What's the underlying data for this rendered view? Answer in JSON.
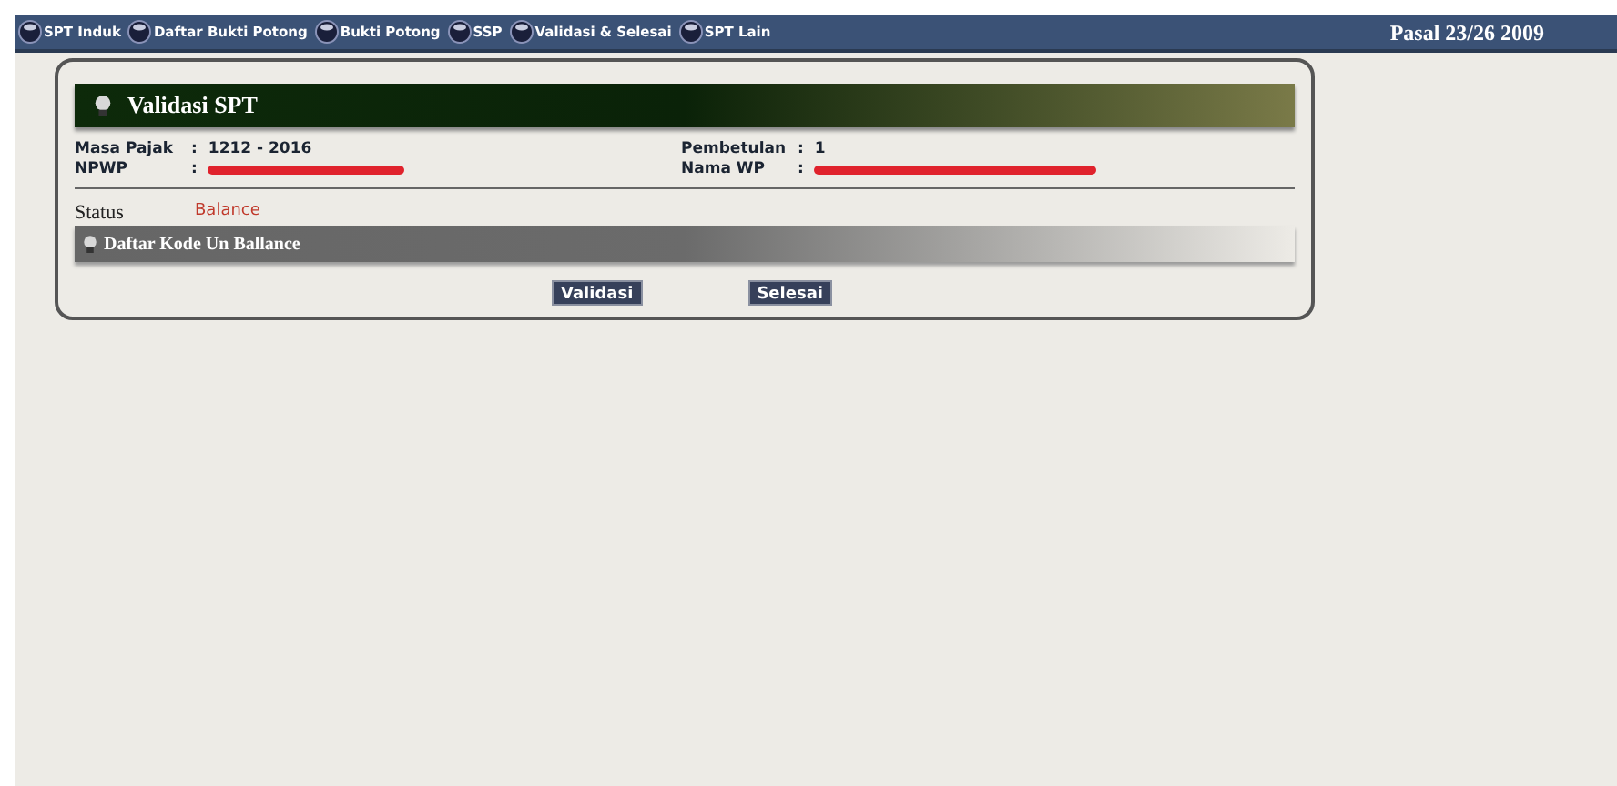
{
  "menu": [
    {
      "label": "SPT Induk"
    },
    {
      "label": "Daftar Bukti Potong"
    },
    {
      "label": "Bukti Potong"
    },
    {
      "label": "SSP"
    },
    {
      "label": "Validasi & Selesai"
    },
    {
      "label": "SPT Lain"
    }
  ],
  "menu_title": "Pasal 23/26 2009",
  "panel": {
    "title": "Validasi SPT",
    "fields_left": [
      {
        "kind": "text",
        "label": "Masa Pajak",
        "separator": ":",
        "value": "1212 - 2016"
      },
      {
        "kind": "redacted",
        "label": "NPWP",
        "separator": ":"
      }
    ],
    "fields_right": [
      {
        "kind": "text",
        "label": "Pembetulan",
        "separator": ":",
        "value": "1"
      },
      {
        "kind": "redacted",
        "label": "Nama WP",
        "separator": ":"
      }
    ],
    "status_label": "Status",
    "status_value": "Balance",
    "section_title": "Daftar Kode Un Ballance",
    "buttons": [
      "Validasi",
      "Selesai"
    ]
  }
}
